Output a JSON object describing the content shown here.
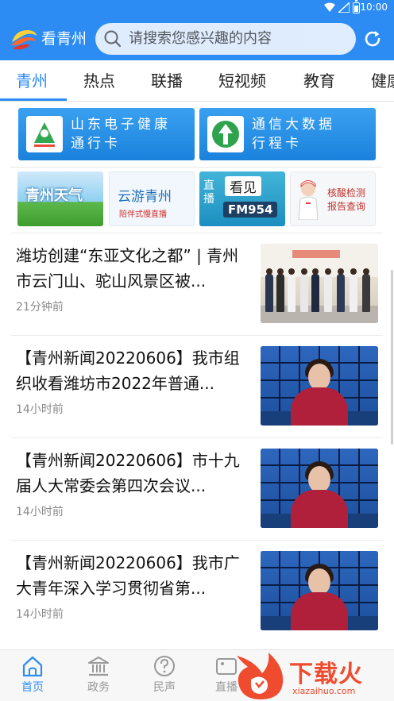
{
  "status_bar": {
    "time": "10:00"
  },
  "header": {
    "brand": "看青州",
    "search_placeholder": "请搜索您感兴趣的内容"
  },
  "tabs": [
    {
      "label": "青州",
      "active": true
    },
    {
      "label": "热点"
    },
    {
      "label": "联播"
    },
    {
      "label": "短视频"
    },
    {
      "label": "教育"
    },
    {
      "label": "健康"
    }
  ],
  "banners": [
    {
      "line1": "山东电子健康",
      "line2": "通行卡",
      "icon": "health-code-icon"
    },
    {
      "line1": "通信大数据",
      "line2": "行程卡",
      "icon": "trip-card-icon"
    }
  ],
  "tiles": [
    {
      "label": "青州天气"
    },
    {
      "label": "云游青州",
      "sub": "陪伴式慢直播"
    },
    {
      "live": "直播",
      "label": "看见",
      "sub": "FM954"
    },
    {
      "label": "核酸检测报告查询"
    }
  ],
  "news": [
    {
      "title": "潍坊创建“东亚文化之都” | 青州市云门山、驼山风景区被...",
      "time": "21分钟前",
      "thumb": "photo"
    },
    {
      "title": "【青州新闻20220606】我市组织收看潍坊市2022年普通...",
      "time": "14小时前",
      "thumb": "tv"
    },
    {
      "title": "【青州新闻20220606】市十九届人大常委会第四次会议...",
      "time": "14小时前",
      "thumb": "tv"
    },
    {
      "title": "【青州新闻20220606】我市广大青年深入学习贯彻省第...",
      "time": "14小时前",
      "thumb": "tv"
    }
  ],
  "bottom_nav": [
    {
      "label": "首页",
      "icon": "home-icon",
      "active": true
    },
    {
      "label": "政务",
      "icon": "government-icon"
    },
    {
      "label": "民声",
      "icon": "question-icon"
    },
    {
      "label": "直播",
      "icon": "live-icon"
    }
  ],
  "watermark": {
    "text": "下载火",
    "sub": "xiazaihuo.com"
  },
  "colors": {
    "accent": "#2c8cf3",
    "watermark": "#ef4b2f"
  }
}
